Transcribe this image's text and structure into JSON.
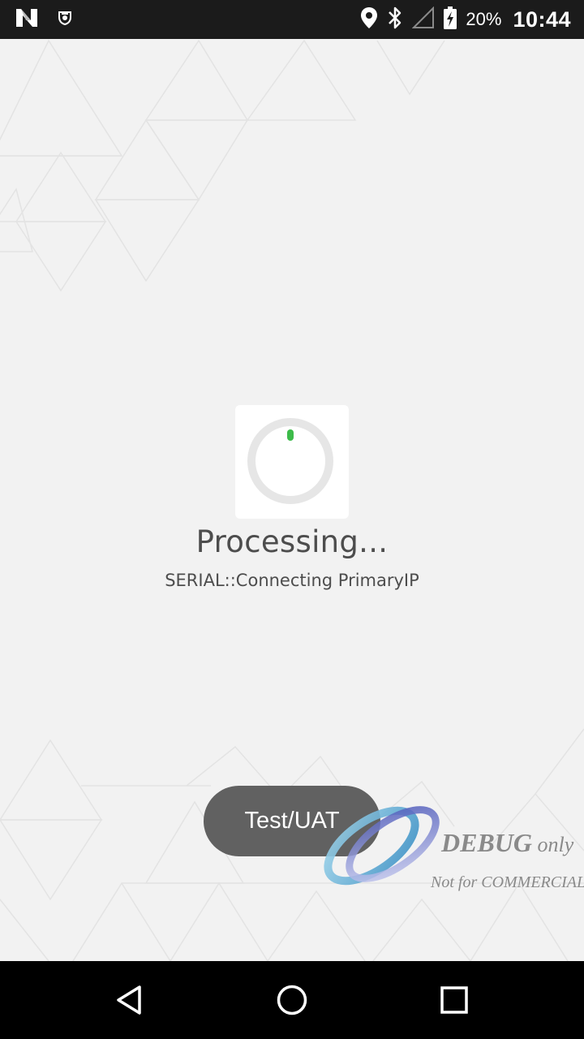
{
  "status_bar": {
    "left_icons": [
      "n-app-icon",
      "shield-app-icon"
    ],
    "right_icons": [
      "location-icon",
      "bluetooth-icon",
      "signal-icon",
      "battery-charging-icon"
    ],
    "battery": "20%",
    "time": "10:44"
  },
  "loader": {
    "title": "Processing...",
    "message": "SERIAL::Connecting PrimaryIP",
    "accent_color": "#3dbb4a"
  },
  "environment_badge": {
    "label": "Test/UAT"
  },
  "watermark": {
    "line1_bold": "DEBUG",
    "line1_rest": " only",
    "line2": "Not for COMMERCIAL"
  },
  "nav_bar": {
    "buttons": [
      "back-icon",
      "home-icon",
      "recents-icon"
    ]
  }
}
